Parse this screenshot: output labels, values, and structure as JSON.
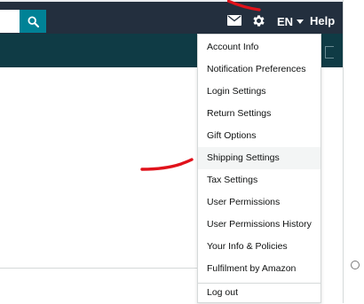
{
  "header": {
    "search": {
      "value": "",
      "placeholder": ""
    },
    "icons": {
      "search": "search-icon",
      "mail": "mail-icon",
      "settings": "gear-icon",
      "language_caret": "chevron-down-icon"
    },
    "language_label": "EN",
    "help_label": "Help"
  },
  "settings_menu": {
    "items": [
      {
        "label": "Account Info"
      },
      {
        "label": "Notification Preferences"
      },
      {
        "label": "Login Settings"
      },
      {
        "label": "Return Settings"
      },
      {
        "label": "Gift Options"
      },
      {
        "label": "Shipping Settings"
      },
      {
        "label": "Tax Settings"
      },
      {
        "label": "User Permissions"
      },
      {
        "label": "User Permissions History"
      },
      {
        "label": "Your Info & Policies"
      },
      {
        "label": "Fulfilment by Amazon"
      },
      {
        "label": "Log out"
      }
    ],
    "highlighted_item": "Shipping Settings"
  },
  "colors": {
    "header_bg": "#232f3e",
    "subnav_bg": "#0f3b45",
    "search_button": "#008296",
    "menu_hover": "#f3f5f5",
    "annotation": "#e0121b"
  }
}
